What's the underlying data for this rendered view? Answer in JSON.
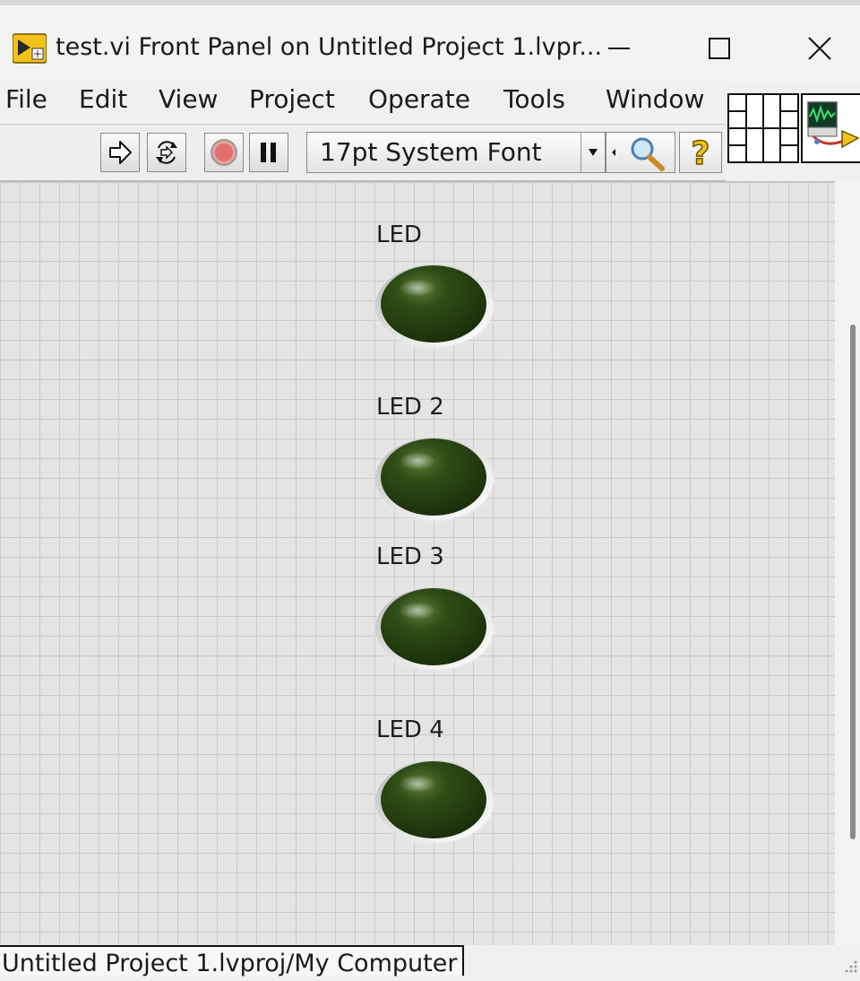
{
  "window": {
    "title": "test.vi Front Panel on Untitled Project 1.lvpr...",
    "controls": [
      "minimize-icon",
      "maximize-icon",
      "close-icon"
    ]
  },
  "menu": {
    "items": [
      "File",
      "Edit",
      "View",
      "Project",
      "Operate",
      "Tools",
      "Window"
    ]
  },
  "toolbar": {
    "font_selector": "17pt System Font",
    "icons": [
      "run-arrow-icon",
      "run-continuously-icon",
      "abort-icon",
      "pause-icon",
      "search-icon",
      "help-icon"
    ]
  },
  "panel": {
    "leds": [
      {
        "label": "LED",
        "state": "off"
      },
      {
        "label": "LED 2",
        "state": "off"
      },
      {
        "label": "LED 3",
        "state": "off"
      },
      {
        "label": "LED 4",
        "state": "off"
      }
    ],
    "led_color_off": "#2e4a16"
  },
  "status": {
    "context": "Untitled Project 1.lvproj/My Computer"
  },
  "colors": {
    "accent_yellow": "#f2c21b",
    "abort_red": "#e07070"
  }
}
